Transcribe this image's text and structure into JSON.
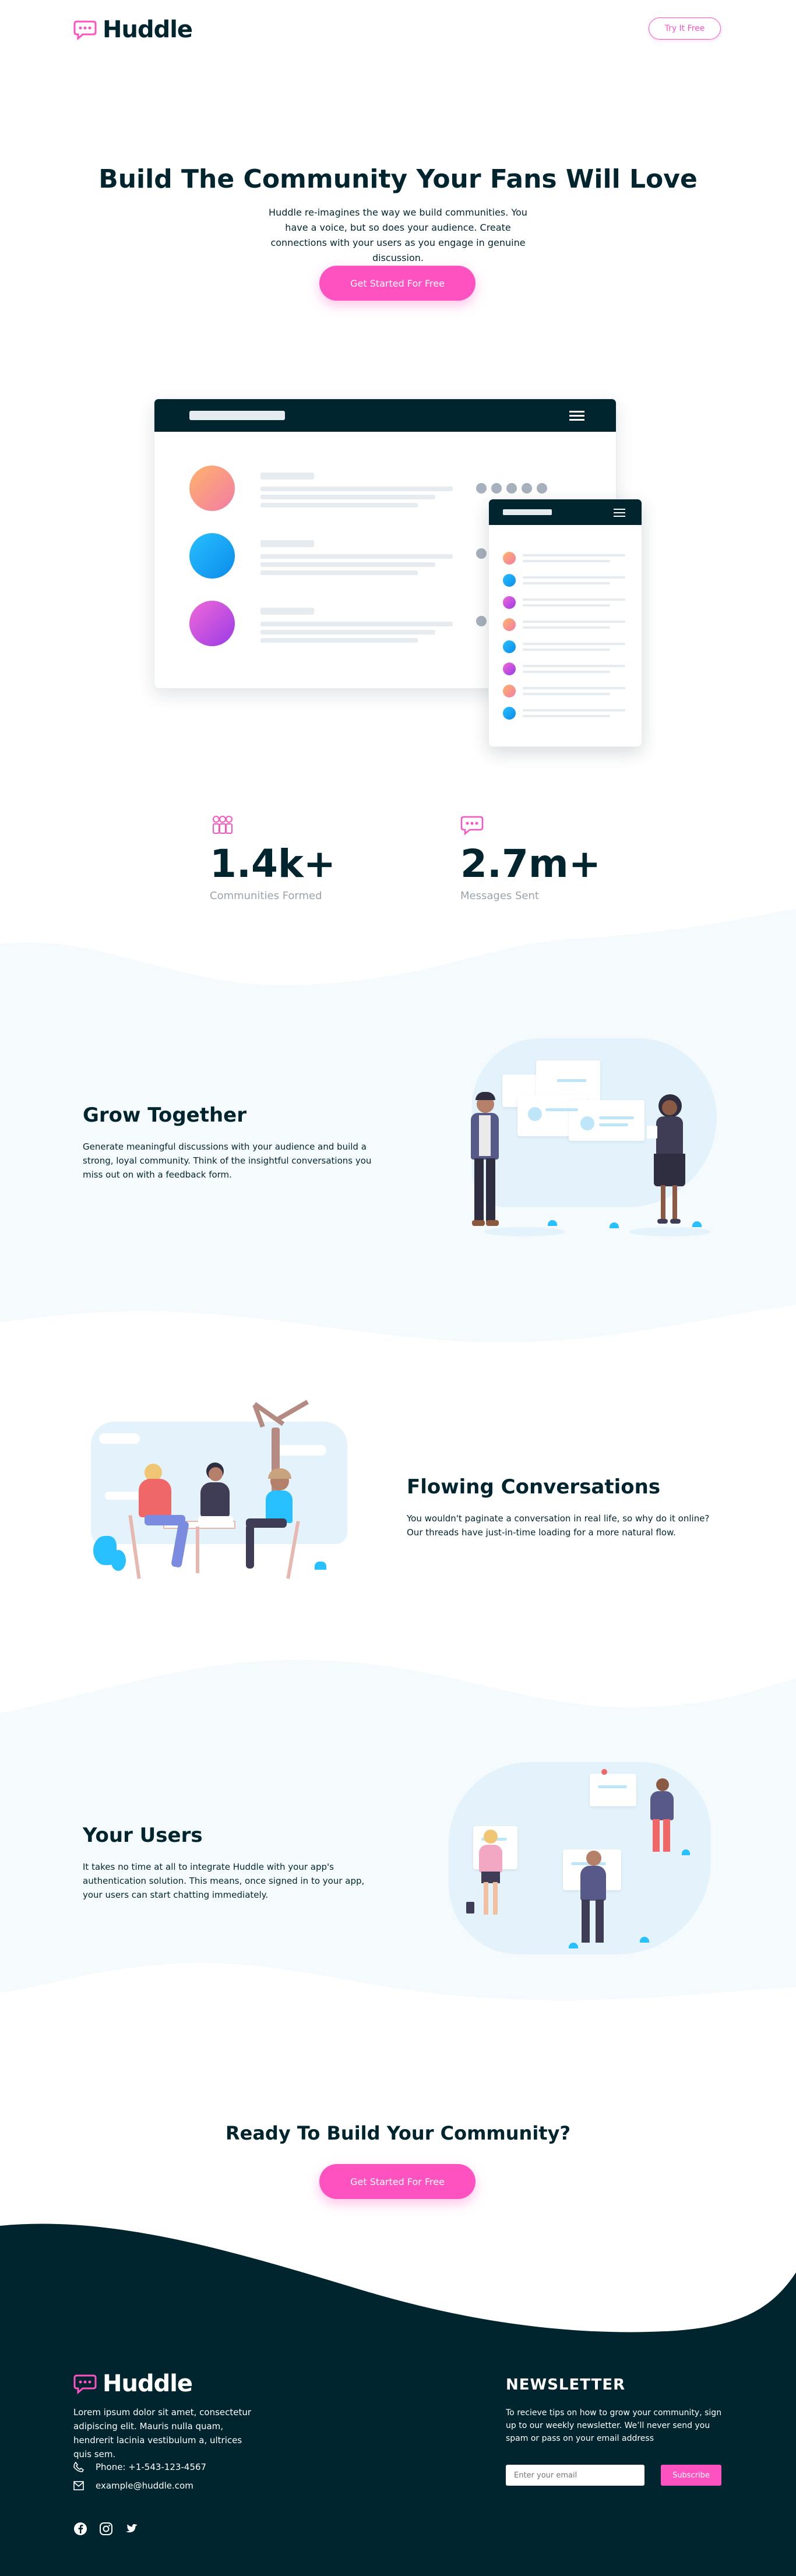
{
  "header": {
    "brand": "Huddle",
    "cta_label": "Try It Free"
  },
  "hero": {
    "title": "Build The Community Your Fans Will Love",
    "description": "Huddle re-imagines the way we build communities. You have a voice, but so does your audience. Create connections with your users as you engage in genuine discussion.",
    "cta_label": "Get Started For Free"
  },
  "stats": [
    {
      "icon": "communities-icon",
      "value": "1.4k+",
      "label": "Communities Formed"
    },
    {
      "icon": "messages-icon",
      "value": "2.7m+",
      "label": "Messages Sent"
    }
  ],
  "features": [
    {
      "title": "Grow Together",
      "text": "Generate meaningful discussions with your audience and build a strong, loyal community. Think of the insightful conversations you miss out on with a feedback form."
    },
    {
      "title": "Flowing Conversations",
      "text": "You wouldn't paginate a conversation in real life, so why do it online? Our threads have just-in-time loading for a more natural flow."
    },
    {
      "title": "Your Users",
      "text": "It takes no time at all to integrate Huddle with your app's authentication solution. This means, once signed in to your app, your users can start chatting immediately."
    }
  ],
  "cta": {
    "title": "Ready To Build Your Community?",
    "button_label": "Get Started For Free"
  },
  "footer": {
    "brand": "Huddle",
    "about": "Lorem ipsum dolor sit amet, consectetur adipiscing elit. Mauris nulla quam, hendrerit lacinia vestibulum a, ultrices quis sem.",
    "phone": "Phone: +1-543-123-4567",
    "email": "example@huddle.com",
    "newsletter_title": "NEWSLETTER",
    "newsletter_text": "To recieve tips on how to grow your community, sign up to our weekly newsletter. We’ll never send you spam or pass on your email address",
    "email_placeholder": "Enter your email",
    "subscribe_label": "Subscribe",
    "social": [
      "facebook-icon",
      "instagram-icon",
      "twitter-icon"
    ]
  },
  "colors": {
    "pink": "#ff52c1",
    "dark": "#00252e",
    "light_bg": "#f5fafd",
    "muted": "#9aa3ab"
  }
}
